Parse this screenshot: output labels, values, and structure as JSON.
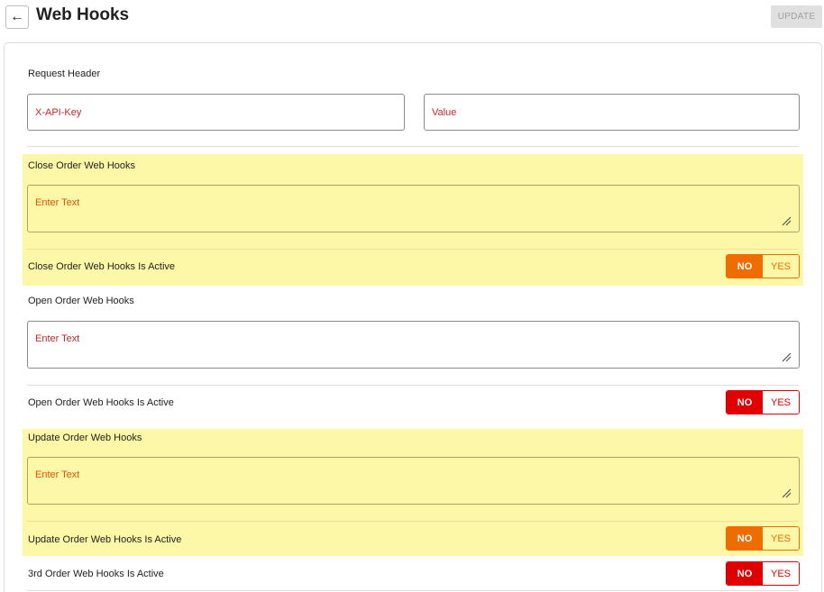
{
  "header": {
    "back_icon": "←",
    "title": "Web Hooks",
    "update_label": "UPDATE"
  },
  "request_header": {
    "label": "Request Header",
    "key_placeholder": "X-API-Key",
    "value_placeholder": "Value"
  },
  "close_order": {
    "label": "Close Order Web Hooks",
    "placeholder": "Enter Text",
    "active_label": "Close Order Web Hooks Is Active",
    "toggle_no": "NO",
    "toggle_yes": "YES"
  },
  "open_order": {
    "label": "Open Order Web Hooks",
    "placeholder": "Enter Text",
    "active_label": "Open Order Web Hooks Is Active",
    "toggle_no": "NO",
    "toggle_yes": "YES"
  },
  "update_order": {
    "label": "Update Order Web Hooks",
    "placeholder": "Enter Text",
    "active_label": "Update Order Web Hooks Is Active",
    "toggle_no": "NO",
    "toggle_yes": "YES"
  },
  "third_order": {
    "active_label": "3rd Order Web Hooks Is Active",
    "toggle_no": "NO",
    "toggle_yes": "YES"
  },
  "colors": {
    "highlight": "#fdf7a8",
    "toggle_red": "#e00000",
    "toggle_orange": "#ef6c00",
    "placeholder_red": "#c62828"
  }
}
